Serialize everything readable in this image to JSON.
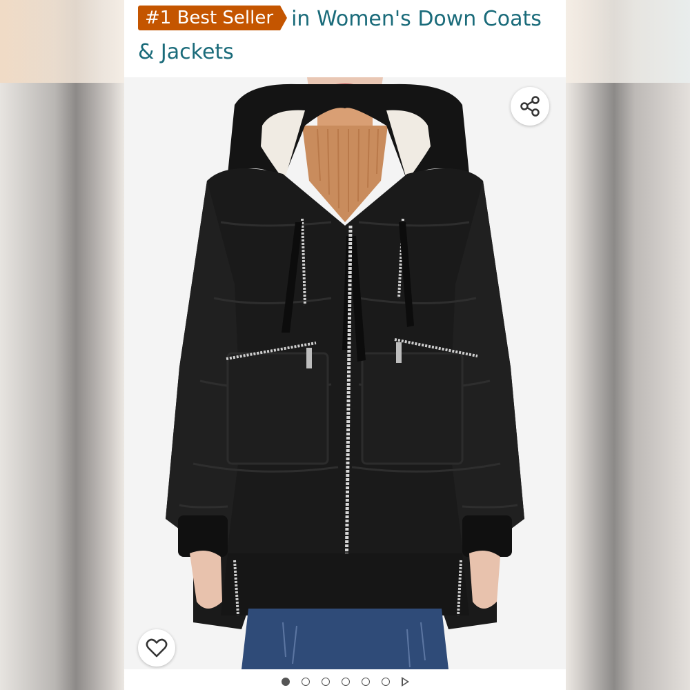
{
  "header": {
    "badge_label": "#1 Best Seller",
    "category_text": "in Women's Down Coats & Jackets"
  },
  "product_image": {
    "alt": "Black hooded down parka with zipper pockets"
  },
  "actions": {
    "share_icon": "share-icon",
    "favorite_icon": "heart-icon"
  },
  "carousel": {
    "image_count": 6,
    "active_index": 0,
    "has_video": true
  },
  "colors": {
    "badge": "#c45500",
    "heading_link": "#1a6b7a"
  }
}
